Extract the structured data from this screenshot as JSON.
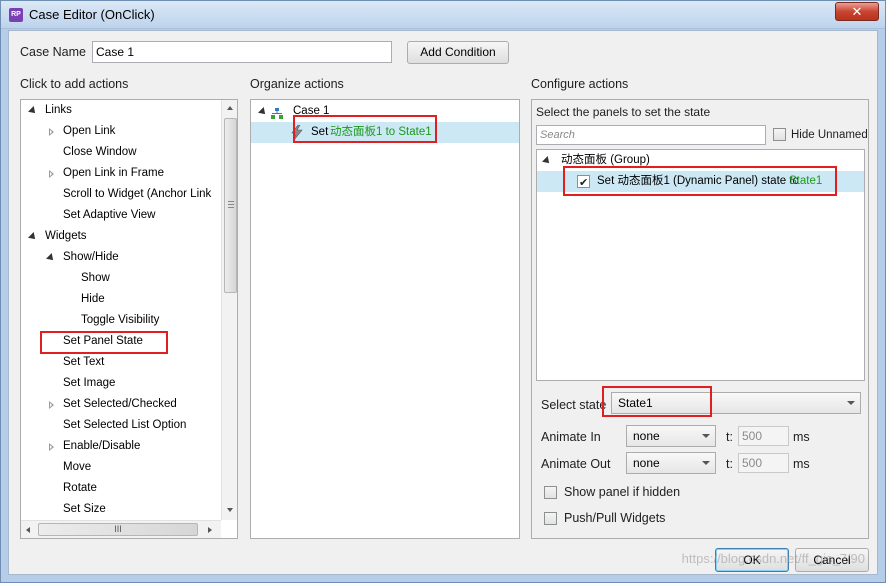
{
  "window": {
    "title": "Case Editor (OnClick)",
    "app_icon_text": "RP",
    "close_symbol": "✕"
  },
  "case_name": {
    "label": "Case Name",
    "value": "Case 1",
    "add_condition_label": "Add Condition"
  },
  "left": {
    "header": "Click to add actions",
    "items": [
      {
        "label": "Links",
        "expander": "expanded",
        "level": 0
      },
      {
        "label": "Open Link",
        "expander": "collapsed",
        "level": 1
      },
      {
        "label": "Close Window",
        "expander": "none",
        "level": 1
      },
      {
        "label": "Open Link in Frame",
        "expander": "collapsed",
        "level": 1
      },
      {
        "label": "Scroll to Widget (Anchor Link",
        "expander": "none",
        "level": 1
      },
      {
        "label": "Set Adaptive View",
        "expander": "none",
        "level": 1
      },
      {
        "label": "Widgets",
        "expander": "expanded",
        "level": 0
      },
      {
        "label": "Show/Hide",
        "expander": "expanded",
        "level": 1
      },
      {
        "label": "Show",
        "expander": "none",
        "level": 2
      },
      {
        "label": "Hide",
        "expander": "none",
        "level": 2
      },
      {
        "label": "Toggle Visibility",
        "expander": "none",
        "level": 2
      },
      {
        "label": "Set Panel State",
        "expander": "none",
        "level": 1
      },
      {
        "label": "Set Text",
        "expander": "none",
        "level": 1
      },
      {
        "label": "Set Image",
        "expander": "none",
        "level": 1
      },
      {
        "label": "Set Selected/Checked",
        "expander": "collapsed",
        "level": 1
      },
      {
        "label": "Set Selected List Option",
        "expander": "none",
        "level": 1
      },
      {
        "label": "Enable/Disable",
        "expander": "collapsed",
        "level": 1
      },
      {
        "label": "Move",
        "expander": "none",
        "level": 1
      },
      {
        "label": "Rotate",
        "expander": "none",
        "level": 1
      },
      {
        "label": "Set Size",
        "expander": "none",
        "level": 1
      }
    ],
    "hscroll_grip": "III"
  },
  "middle": {
    "header": "Organize actions",
    "case_label": "Case 1",
    "action_prefix": "Set ",
    "action_target": "动态面板1 to State1"
  },
  "right": {
    "header": "Configure actions",
    "subheader": "Select the panels to set the state",
    "search_placeholder": "Search",
    "hide_unnamed_label": "Hide Unnamed",
    "group_label": "动态面板 (Group)",
    "panel_item_prefix": "Set 动态面板1 (Dynamic Panel) state to ",
    "panel_item_state": "State1",
    "select_state_label": "Select state",
    "select_state_value": "State1",
    "animate_in_label": "Animate In",
    "animate_in_value": "none",
    "animate_out_label": "Animate Out",
    "animate_out_value": "none",
    "t_label": "t:",
    "t_in_value": "500",
    "t_out_value": "500",
    "ms_label": "ms",
    "show_panel_label": "Show panel if hidden",
    "push_pull_label": "Push/Pull Widgets"
  },
  "footer": {
    "ok_label": "OK",
    "cancel_label": "Cancel",
    "watermark": "https://blog.csdn.net/ff_gis_7/90"
  },
  "colors": {
    "highlight_red": "#e02020",
    "state_green": "#1a9a1a",
    "selection_blue": "#cce8f5"
  }
}
